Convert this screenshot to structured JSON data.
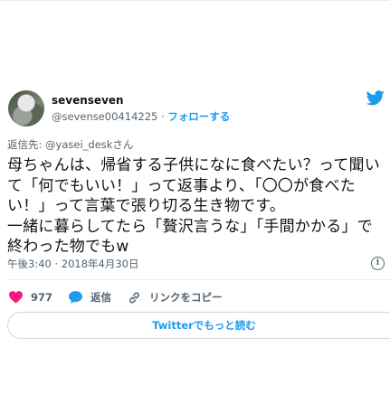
{
  "tweet": {
    "display_name": "sevenseven",
    "handle": "@sevense00414225",
    "separator": "·",
    "follow_label": "フォローする",
    "reply_to": "返信先: @yasei_deskさん",
    "body_lines": [
      "母ちゃんは、帰省する子供になに食べたい？って聞い",
      "て「何でもいい！」って返事より、「〇〇が食べた",
      "い！」って言葉で張り切る生き物です。",
      "一緒に暮らしてたら「贅沢言うな」「手間かかる」で",
      "終わった物でもw"
    ],
    "timestamp": "午後3:40 · 2018年4月30日",
    "likes": "977",
    "reply_label": "返信",
    "copy_link_label": "リンクをコピー",
    "read_more_label": "Twitterでもっと読む"
  },
  "colors": {
    "accent": "#1d9bf0",
    "like": "#f91880",
    "muted": "#536471",
    "text": "#0f1419"
  },
  "icons": [
    "twitter-bird-icon",
    "heart-icon",
    "reply-bubble-icon",
    "link-icon",
    "info-icon"
  ]
}
